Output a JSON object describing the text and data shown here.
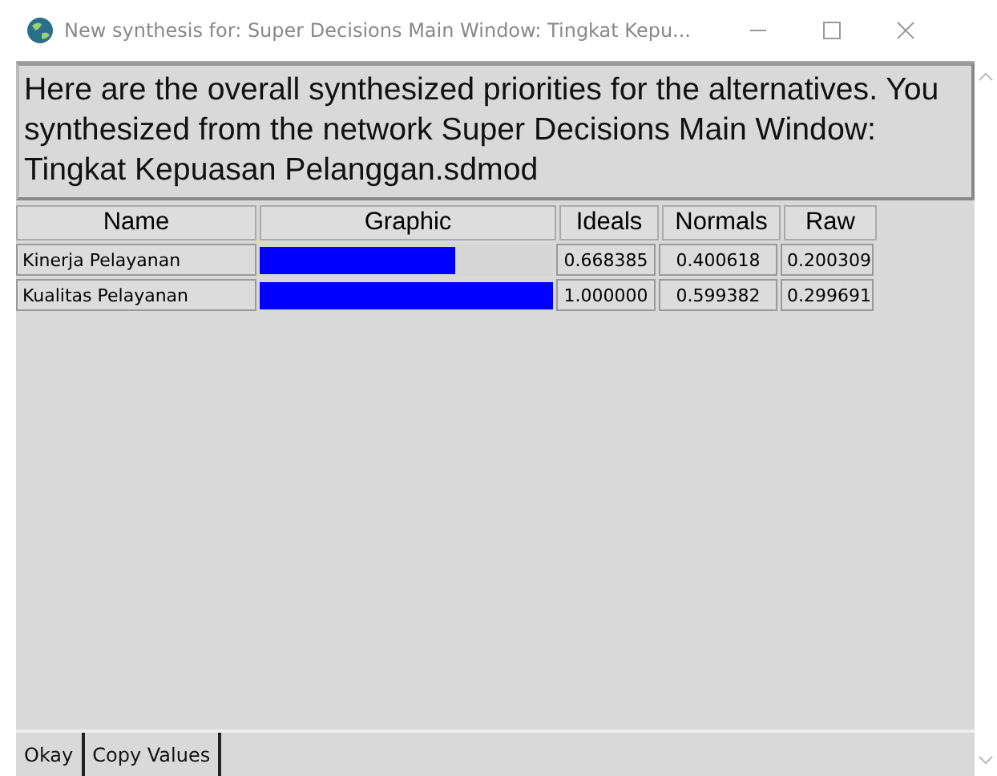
{
  "window": {
    "title": "New synthesis for: Super Decisions Main Window: Tingkat Kepu..."
  },
  "message": "Here are the overall synthesized priorities for the alternatives. You synthesized from the network Super Decisions Main Window: Tingkat Kepuasan Pelanggan.sdmod",
  "table": {
    "columns": [
      "Name",
      "Graphic",
      "Ideals",
      "Normals",
      "Raw"
    ],
    "rows": [
      {
        "name": "Kinerja Pelayanan",
        "level": 0.668385,
        "ideals": "0.668385",
        "normals": "0.400618",
        "raw": "0.200309"
      },
      {
        "name": "Kualitas Pelayanan",
        "level": 1.0,
        "ideals": "1.000000",
        "normals": "0.599382",
        "raw": "0.299691"
      }
    ]
  },
  "buttons": [
    "Okay",
    "Copy Values"
  ]
}
